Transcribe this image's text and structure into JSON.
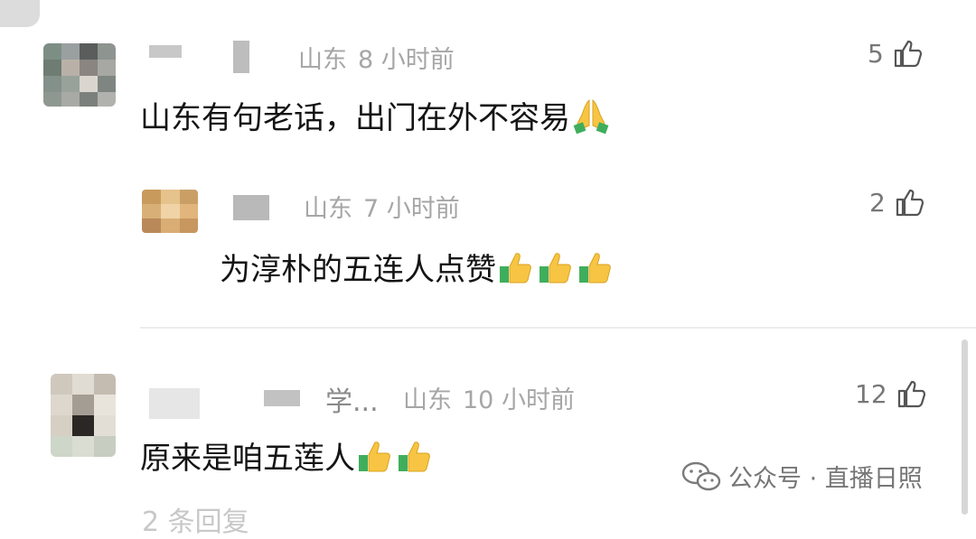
{
  "comments": [
    {
      "location": "山东",
      "time": "8 小时前",
      "text": "山东有句老话，出门在外不容易",
      "emoji": "pray",
      "likes": "5"
    },
    {
      "location": "山东",
      "time": "7 小时前",
      "text": "为淳朴的五连人点赞",
      "emoji": "thumbs-up",
      "likes": "2"
    },
    {
      "username_visible": "学...",
      "location": "山东",
      "time": "10 小时前",
      "text": "原来是咱五莲人",
      "emoji": "thumbs-up",
      "likes": "12"
    }
  ],
  "more_replies": "2 条回复",
  "watermark": "公众号 · 直播日照",
  "colors": {
    "meta_text": "#a6a6a6",
    "content_text": "#141414",
    "like_text": "#777777",
    "divider": "#ececec"
  }
}
